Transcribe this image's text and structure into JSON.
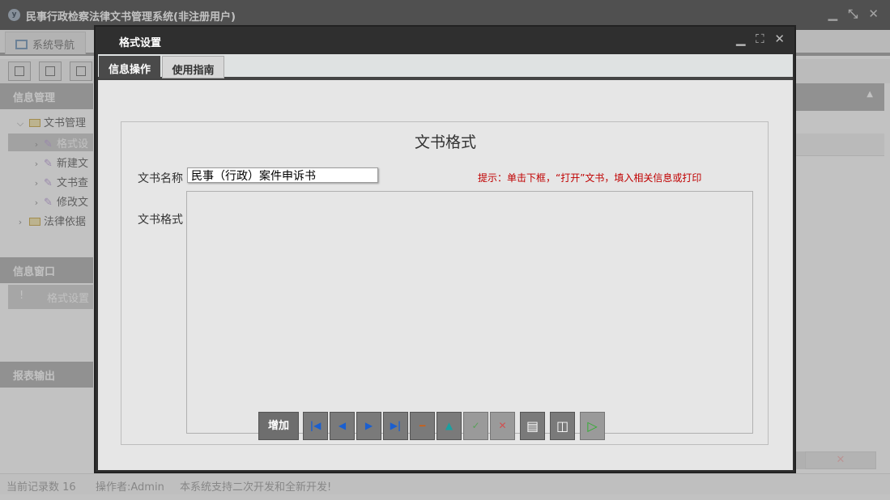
{
  "app": {
    "logo_glyph": "y",
    "title": "民事行政检察法律文书管理系统(非注册用户)",
    "controls": "▁ ⤡ ✕"
  },
  "nav": {
    "tab_label": "系统导航"
  },
  "sidebar": {
    "info_mgmt": "信息管理",
    "tree": [
      {
        "label": "文书管理",
        "icon": "folder-icon"
      },
      {
        "label": "格式设",
        "icon": "gear-icon"
      },
      {
        "label": "新建文",
        "icon": "gear-icon"
      },
      {
        "label": "文书查",
        "icon": "gear-icon"
      },
      {
        "label": "修改文",
        "icon": "gear-icon"
      },
      {
        "label": "法律依据",
        "icon": "folder-icon"
      }
    ],
    "info_window": "信息窗口",
    "window_item": "格式设置",
    "window_item_marker": "!",
    "report_output": "报表输出"
  },
  "right_panel": {
    "collapse_glyph": "▲",
    "close_glyph": "✕"
  },
  "status": {
    "record_count": "当前记录数 16",
    "operator": "操作者:Admin",
    "notice": "本系统支持二次开发和全新开发!"
  },
  "dialog": {
    "title": "格式设置",
    "controls": "▁ ⛶ ✕",
    "tabs": [
      "信息操作",
      "使用指南"
    ],
    "heading": "文书格式",
    "name_label": "文书名称",
    "name_value": "民事（行政）案件申诉书",
    "hint": "提示：单击下框，“打开”文书，填入相关信息或打印",
    "format_label": "文书格式",
    "buttons": {
      "add": "增加",
      "first": "|◀",
      "prev": "◀",
      "next": "▶",
      "last": "▶|",
      "delete": "−",
      "edit": "▲",
      "confirm": "✓",
      "cancel": "✕",
      "print": "▤",
      "preview": "◫",
      "run": "▷"
    }
  },
  "colors": {
    "hint_red": "#c00000",
    "dialog_dark": "#2f2f2f",
    "nav_blue": "#1a5fd0"
  }
}
